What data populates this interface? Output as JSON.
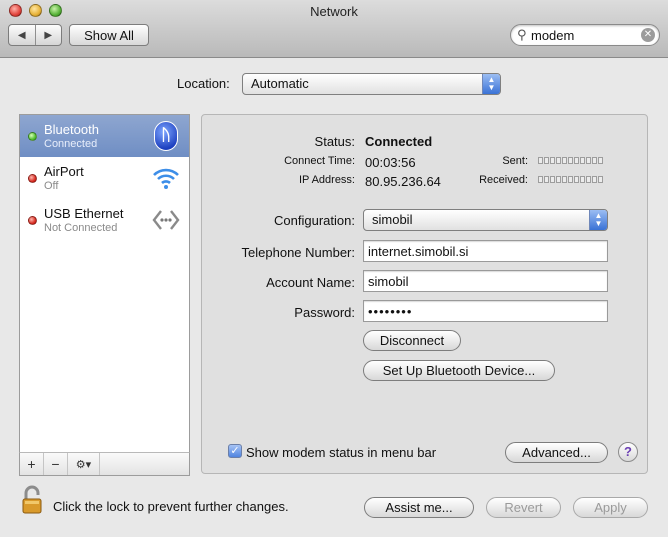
{
  "window": {
    "title": "Network"
  },
  "toolbar": {
    "back_glyph": "◀",
    "forward_glyph": "▶",
    "show_all": "Show All",
    "search_value": "modem",
    "search_clear": "✕"
  },
  "location": {
    "label": "Location:",
    "value": "Automatic"
  },
  "services": [
    {
      "name": "Bluetooth",
      "status": "Connected",
      "state": "green",
      "selected": true,
      "icon": "bluetooth-icon"
    },
    {
      "name": "AirPort",
      "status": "Off",
      "state": "red",
      "selected": false,
      "icon": "wifi-icon"
    },
    {
      "name": "USB Ethernet",
      "status": "Not Connected",
      "state": "red",
      "selected": false,
      "icon": "ethernet-icon"
    }
  ],
  "sidebar_toolbar": {
    "add": "+",
    "remove": "−",
    "action": "⚙▾"
  },
  "details": {
    "status_label": "Status:",
    "status_value": "Connected",
    "connect_time_label": "Connect Time:",
    "connect_time_value": "00:03:56",
    "ip_label": "IP Address:",
    "ip_value": "80.95.236.64",
    "sent_label": "Sent:",
    "received_label": "Received:",
    "configuration_label": "Configuration:",
    "configuration_value": "simobil",
    "telephone_label": "Telephone Number:",
    "telephone_value": "internet.simobil.si",
    "account_label": "Account Name:",
    "account_value": "simobil",
    "password_label": "Password:",
    "password_value": "••••••••",
    "disconnect": "Disconnect",
    "setup_bluetooth": "Set Up Bluetooth Device...",
    "show_modem_status": "Show modem status in menu bar",
    "advanced": "Advanced...",
    "help": "?"
  },
  "footer": {
    "lock_text": "Click the lock to prevent further changes.",
    "assist": "Assist me...",
    "revert": "Revert",
    "apply": "Apply"
  },
  "colors": {
    "selection": "#7d97c8",
    "accent": "#3a72d6",
    "connected": "#4cbc2c",
    "disconnected": "#d4261c"
  }
}
